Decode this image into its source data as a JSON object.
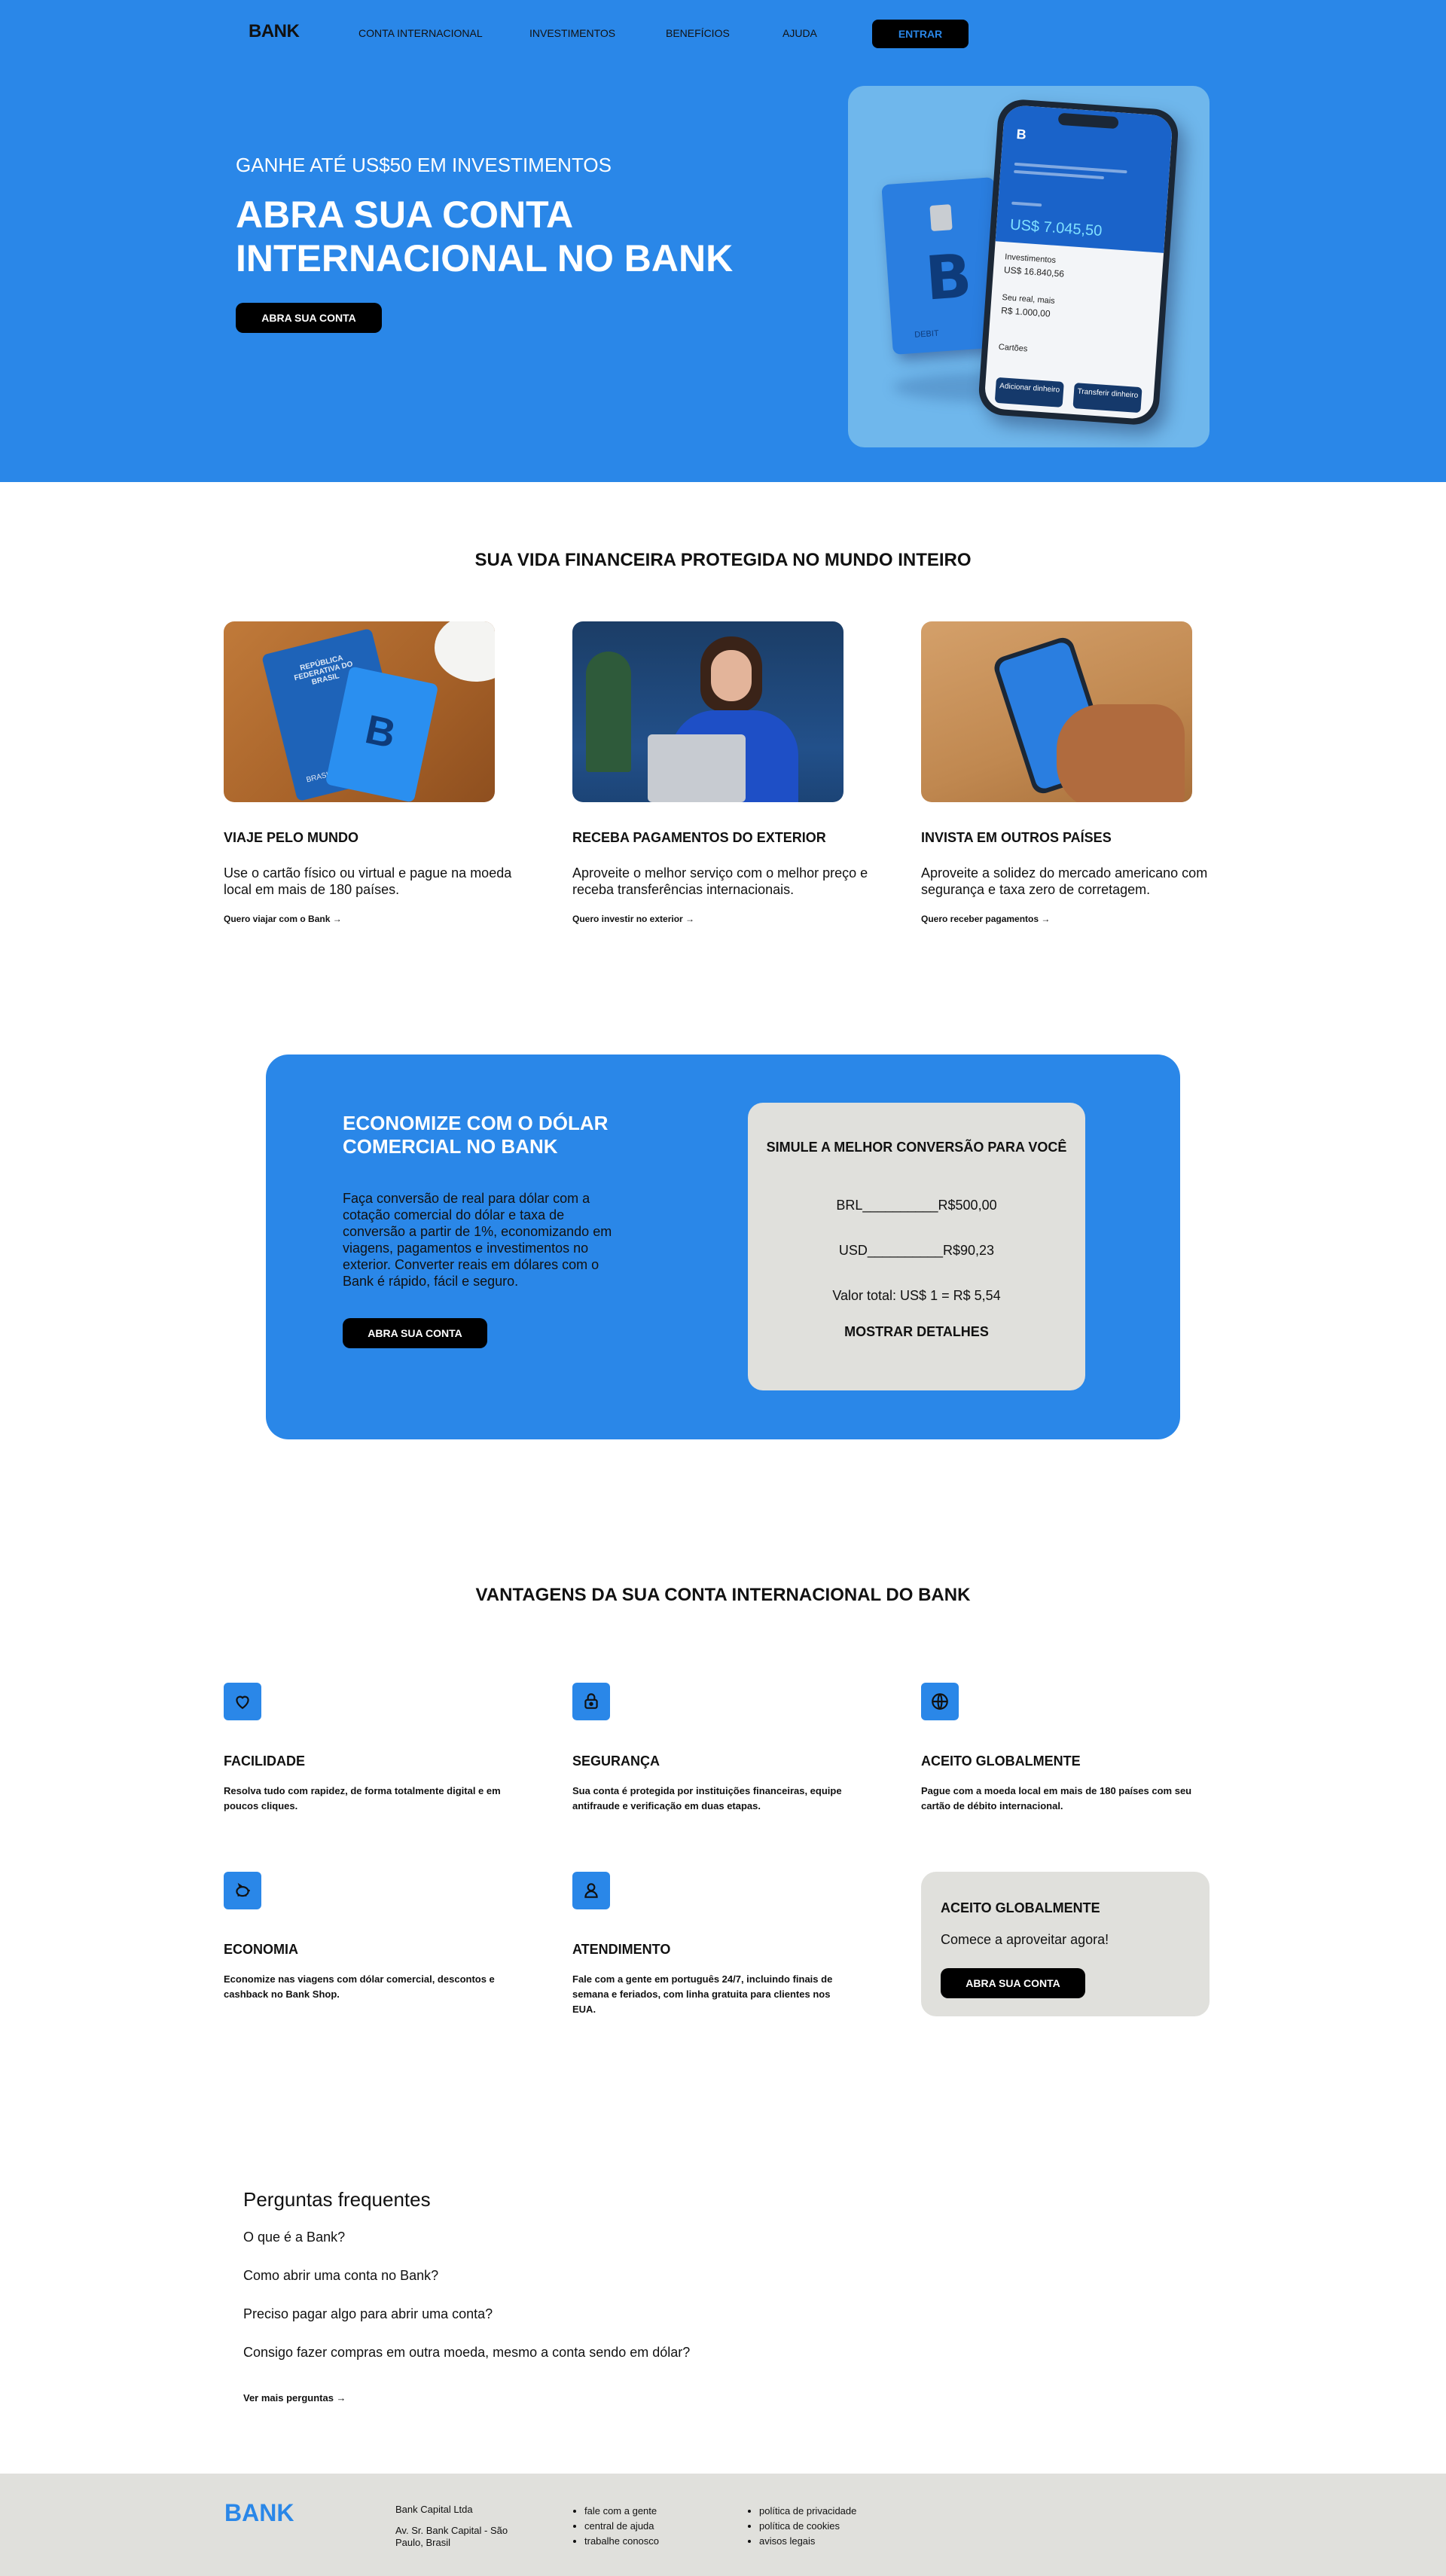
{
  "brand": {
    "name": "BANK",
    "accent": "#2a87e8",
    "footer_bg": "#e0e0dc"
  },
  "nav": {
    "links": [
      "CONTA INTERNACIONAL",
      "INVESTIMENTOS",
      "BENEFÍCIOS",
      "AJUDA"
    ],
    "login": "ENTRAR"
  },
  "hero": {
    "kicker": "GANHE ATÉ US$50 EM INVESTIMENTOS",
    "title": "ABRA SUA CONTA INTERNACIONAL NO BANK",
    "cta": "ABRA SUA CONTA",
    "card": {
      "letter": "B",
      "label": "DEBIT"
    },
    "phone": {
      "logo": "B",
      "balance": "US$ 7.045,50",
      "investments_label": "Investimentos",
      "investments_value": "US$ 16.840,56",
      "savings_label": "Seu real, mais",
      "savings_value": "R$ 1.000,00",
      "cards_label": "Cartões",
      "btn_add": "Adicionar dinheiro",
      "btn_transfer": "Transferir dinheiro"
    }
  },
  "features": {
    "title": "SUA VIDA FINANCEIRA PROTEGIDA NO MUNDO INTEIRO",
    "items": [
      {
        "title": "VIAJE PELO MUNDO",
        "text": "Use o cartão físico ou virtual e pague na moeda local em mais de 180 países.",
        "link": "Quero viajar com o Bank →"
      },
      {
        "title": "RECEBA PAGAMENTOS DO EXTERIOR",
        "text": "Aproveite o melhor serviço com o melhor preço e receba transferências internacionais.",
        "link": "Quero investir no exterior →"
      },
      {
        "title": "INVISTA EM OUTROS PAÍSES",
        "text": "Aproveite a solidez do mercado americano com segurança e taxa zero de corretagem.",
        "link": "Quero receber pagamentos →"
      }
    ],
    "passport_text": "REPÚBLICA FEDERATIVA DO BRASIL",
    "passport_country": "BRASIL",
    "card_letter": "B"
  },
  "conversion": {
    "title": "ECONOMIZE COM O DÓLAR COMERCIAL NO BANK",
    "text": "Faça conversão de real para dólar com a cotação comercial do dólar e taxa de conversão a partir de 1%, economizando em viagens, pagamentos e investimentos no exterior. Converter reais em dólares com o Bank é rápido, fácil e seguro.",
    "cta": "ABRA SUA CONTA",
    "simulator": {
      "title": "SIMULE A MELHOR CONVERSÃO PARA VOCÊ",
      "row_brl": "BRL__________R$500,00",
      "row_usd": "USD__________R$90,23",
      "total": "Valor total: US$ 1 = R$ 5,54",
      "details": "MOSTRAR DETALHES"
    }
  },
  "advantages": {
    "title": "VANTAGENS DA SUA CONTA INTERNACIONAL DO BANK",
    "items": [
      {
        "icon": "heart-icon",
        "title": "FACILIDADE",
        "text": "Resolva tudo com rapidez, de forma totalmente digital e em poucos cliques."
      },
      {
        "icon": "lock-icon",
        "title": "SEGURANÇA",
        "text": "Sua conta é protegida por instituições financeiras, equipe antifraude e verificação em duas etapas."
      },
      {
        "icon": "globe-icon",
        "title": "ACEITO GLOBALMENTE",
        "text": "Pague com a moeda local em mais de 180 países com seu cartão de débito internacional."
      },
      {
        "icon": "piggy-bank-icon",
        "title": "ECONOMIA",
        "text": "Economize nas viagens com dólar comercial, descontos e cashback no Bank Shop."
      },
      {
        "icon": "user-icon",
        "title": "ATENDIMENTO",
        "text": "Fale com a gente em português 24/7, incluindo finais de semana e feriados, com linha gratuita para clientes nos EUA."
      }
    ],
    "cta_box": {
      "title": "ACEITO GLOBALMENTE",
      "text": "Comece a aproveitar agora!",
      "button": "ABRA SUA CONTA"
    }
  },
  "faq": {
    "title": "Perguntas frequentes",
    "questions": [
      "O que é a Bank?",
      "Como abrir uma conta no Bank?",
      "Preciso pagar algo para abrir uma conta?",
      "Consigo fazer compras em outra moeda, mesmo a conta sendo em dólar?"
    ],
    "more": "Ver mais perguntas →"
  },
  "footer": {
    "logo": "BANK",
    "company": "Bank Capital Ltda",
    "address": "Av. Sr. Bank Capital - São Paulo, Brasil",
    "links_col1": [
      "fale com a gente",
      "central de ajuda",
      "trabalhe conosco"
    ],
    "links_col2": [
      "política de privacidade",
      "política de cookies",
      "avisos legais"
    ]
  }
}
